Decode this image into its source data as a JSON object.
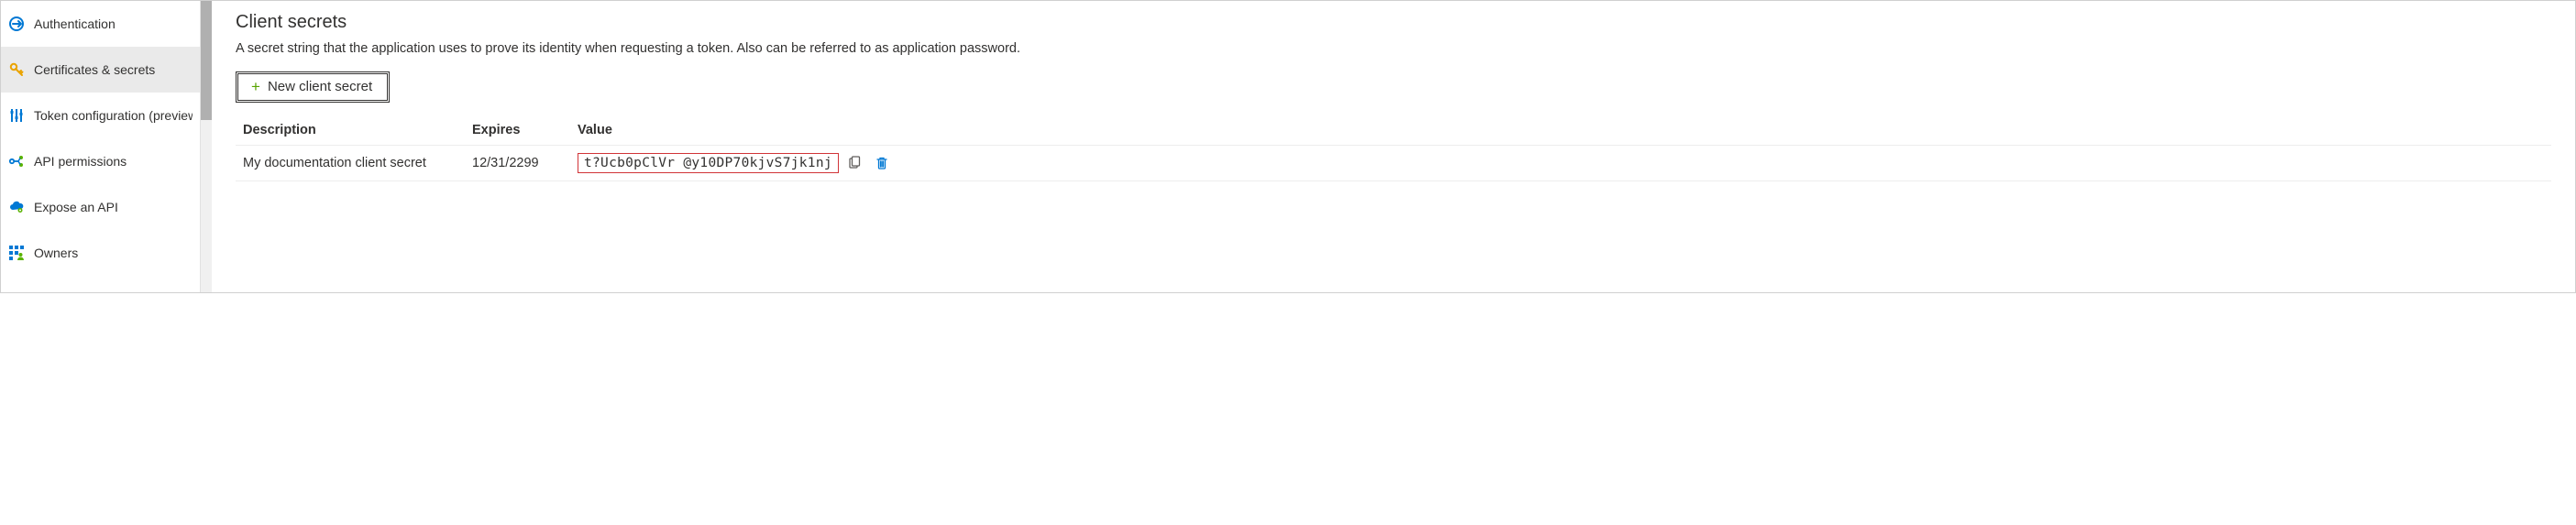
{
  "sidebar": {
    "items": [
      {
        "label": "Authentication"
      },
      {
        "label": "Certificates & secrets"
      },
      {
        "label": "Token configuration (preview)"
      },
      {
        "label": "API permissions"
      },
      {
        "label": "Expose an API"
      },
      {
        "label": "Owners"
      }
    ]
  },
  "main": {
    "section_title": "Client secrets",
    "section_desc": "A secret string that the application uses to prove its identity when requesting a token. Also can be referred to as application password.",
    "new_secret_label": "New client secret",
    "table": {
      "headers": {
        "description": "Description",
        "expires": "Expires",
        "value": "Value"
      },
      "rows": [
        {
          "description": "My documentation client secret",
          "expires": "12/31/2299",
          "value": "t?Ucb0pClVr @y10DP70kjvS7jk1nj"
        }
      ]
    }
  },
  "icons": {
    "authentication": "auth-icon",
    "certificates": "key-icon",
    "token_config": "sliders-icon",
    "api_permissions": "api-perm-icon",
    "expose_api": "cloud-gear-icon",
    "owners": "grid-person-icon",
    "copy": "copy-icon",
    "delete": "trash-icon",
    "plus": "plus-icon"
  },
  "colors": {
    "accent_blue": "#0078d4",
    "warn_orange": "#eaa300",
    "plus_green": "#57a300",
    "highlight_red": "#d13438"
  }
}
